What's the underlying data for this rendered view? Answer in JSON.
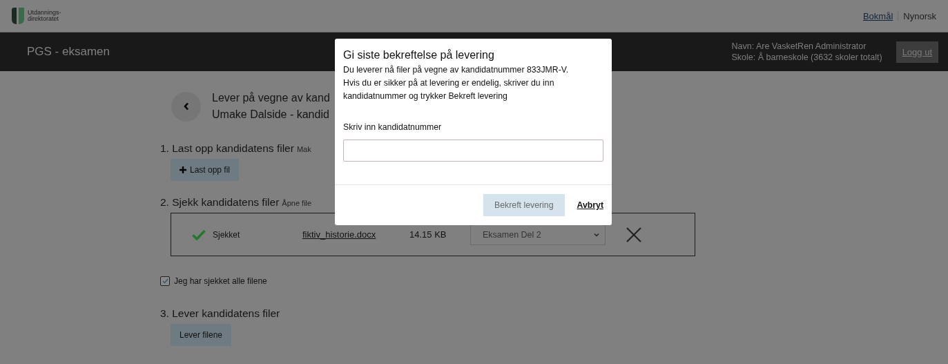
{
  "top_bar": {
    "logo_text": [
      "Utdannings-",
      "direktoratet"
    ],
    "languages": [
      {
        "label": "Bokmål",
        "selected": true
      },
      {
        "label": "Nynorsk",
        "selected": false
      }
    ]
  },
  "header": {
    "app_title": "PGS - eksamen",
    "user_name": "Navn: Are VasketRen Administrator",
    "school": "Skole: Å barneskole (3632 skoler totalt)",
    "logout": "Logg ut"
  },
  "page": {
    "title_lines": [
      "Lever på vegne av kand",
      "Umake Dalside - kandid"
    ],
    "step_1": {
      "heading": "1. Last opp kandidatens filer",
      "hint": "Mak",
      "button": "Last opp fil"
    },
    "step_2": {
      "heading": "2. Sjekk kandidatens filer",
      "hint": "Åpne file",
      "files": [
        {
          "status": "Sjekket",
          "checked": true,
          "name": "fiktiv_historie.docx",
          "size": "14.15 KB",
          "part": "Eksamen Del 2"
        }
      ],
      "confirm": {
        "label": "Jeg har sjekket alle filene",
        "checked": true
      }
    },
    "step_3": {
      "heading": "3. Lever kandidatens filer",
      "button": "Lever filene"
    }
  },
  "dialog": {
    "title": "Gi siste bekreftelse på levering",
    "message": [
      "Du leverer nå filer på vegne av kandidatnummer 833JMR-V.",
      "Hvis du er sikker på at levering er endelig, skriver du inn",
      "kandidatnummer og trykker Bekreft levering"
    ],
    "field_label": "Skriv inn kandidatnummer",
    "confirm_button": {
      "label": "Bekreft levering",
      "disabled": true
    },
    "cancel": "Avbryt"
  }
}
